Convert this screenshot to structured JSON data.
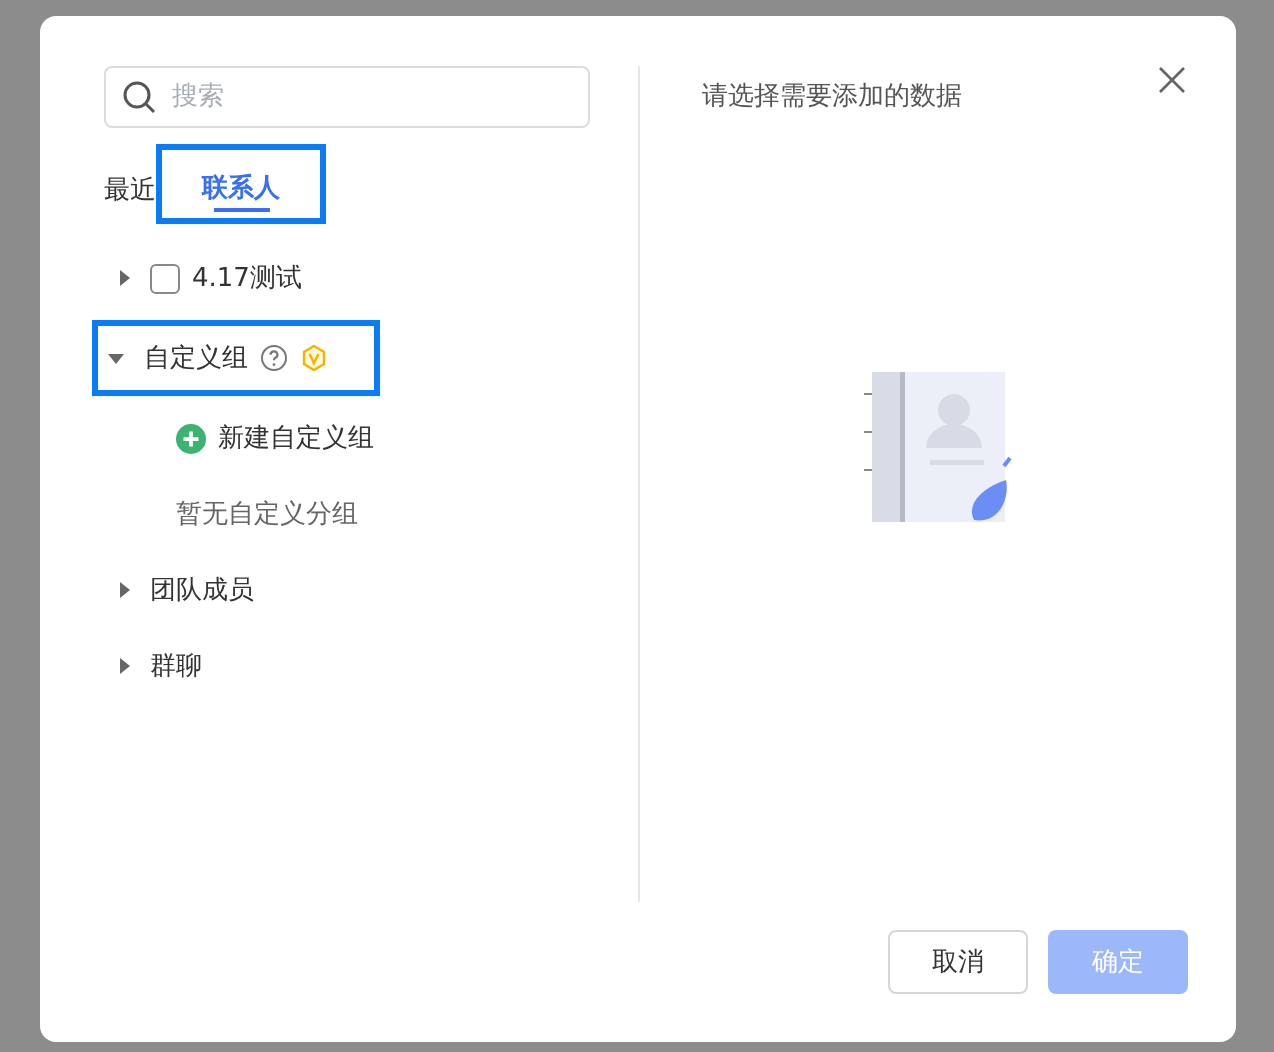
{
  "search": {
    "placeholder": "搜索"
  },
  "tabs": [
    {
      "label": "最近",
      "selected": false,
      "highlighted": false
    },
    {
      "label": "联系人",
      "selected": true,
      "highlighted": true
    }
  ],
  "tree": [
    {
      "label": "4.17测试",
      "kind": "checkbox",
      "checked": false,
      "expanded": false,
      "highlighted": false
    },
    {
      "label": "自定义组",
      "kind": "group",
      "expanded": true,
      "highlighted": true,
      "help": true,
      "vip": true,
      "children": [
        {
          "label": "新建自定义组",
          "kind": "add"
        },
        {
          "label": "暂无自定义分组",
          "kind": "empty"
        }
      ]
    },
    {
      "label": "团队成员",
      "kind": "group",
      "expanded": false,
      "highlighted": false
    },
    {
      "label": "群聊",
      "kind": "group",
      "expanded": false,
      "highlighted": false
    }
  ],
  "right_panel": {
    "title": "请选择需要添加的数据"
  },
  "buttons": [
    {
      "label": "取消",
      "kind": "secondary",
      "disabled": false
    },
    {
      "label": "确定",
      "kind": "primary",
      "disabled": true
    }
  ]
}
